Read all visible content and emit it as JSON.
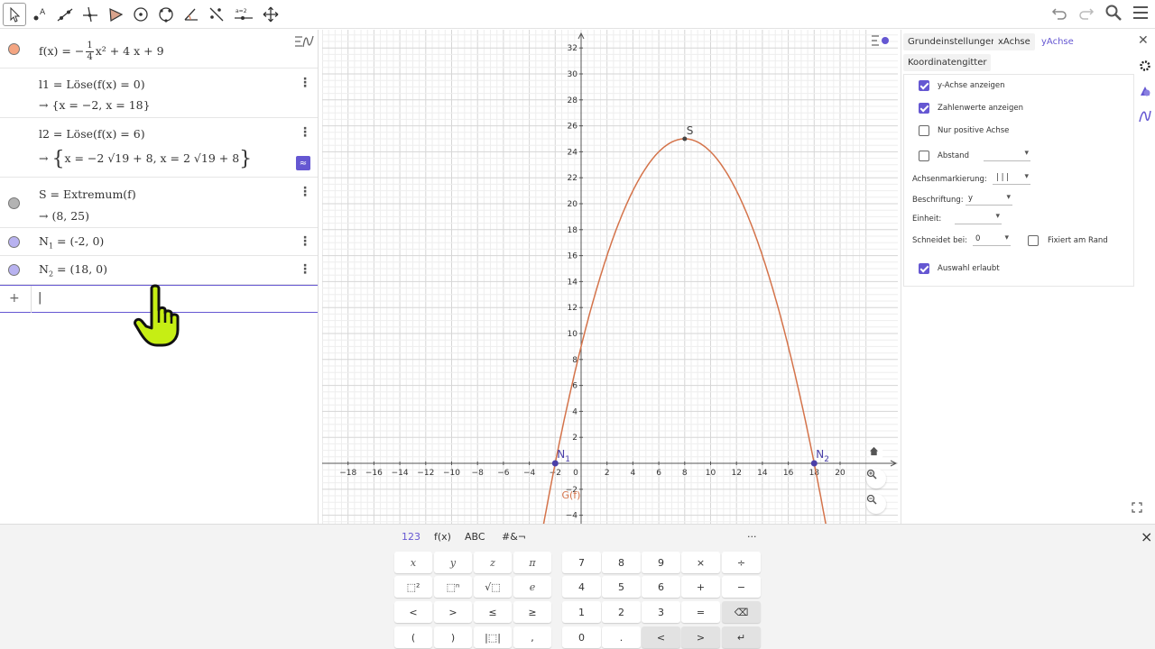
{
  "toolbar": {
    "tools": [
      "move-tool",
      "point-tool",
      "line-tool",
      "perpendicular-tool",
      "polygon-tool",
      "circle-tool",
      "circle-three-points-tool",
      "angle-tool",
      "reflect-tool",
      "slider-tool",
      "move-view-tool"
    ],
    "right": [
      "undo-icon",
      "redo-icon",
      "search-icon",
      "menu-icon"
    ],
    "slider_label": "a=2"
  },
  "algebra": {
    "rows": [
      {
        "id": "f",
        "prefix": "f(x) = −",
        "frac_num": "1",
        "frac_den": "4",
        "suffix": "x² + 4 x + 9",
        "color": "#f4a582"
      },
      {
        "id": "l1",
        "expr": "l1 = Löse(f(x) = 0)",
        "out": "→ {x = −2, x = 18}"
      },
      {
        "id": "l2",
        "expr": "l2 = Löse(f(x) = 6)",
        "out_a": "→ ",
        "out_b": "x = −2 √19 + 8, x = 2 √19 + 8",
        "toggle": "≈"
      },
      {
        "id": "s",
        "expr": "S = Extremum(f)",
        "out": "→ (8, 25)",
        "color": "#b3b3b3"
      },
      {
        "id": "n1",
        "expr_a": "N",
        "sub": "1",
        "expr_b": " = (-2, 0)",
        "color": "#b8b2f0"
      },
      {
        "id": "n2",
        "expr_a": "N",
        "sub": "2",
        "expr_b": " = (18, 0)",
        "color": "#b8b2f0"
      }
    ],
    "input_plus": "+",
    "input_value": "|"
  },
  "graphics": {
    "x_ticks": [
      "−18",
      "−16",
      "−14",
      "−12",
      "−10",
      "−8",
      "−6",
      "−4",
      "−2",
      "0",
      "2",
      "4",
      "6",
      "8",
      "10",
      "12",
      "14",
      "16",
      "18",
      "20"
    ],
    "y_ticks": [
      "32",
      "30",
      "28",
      "26",
      "24",
      "22",
      "20",
      "18",
      "16",
      "14",
      "12",
      "10",
      "8",
      "6",
      "4",
      "2",
      "−2",
      "−4"
    ],
    "curve_label": "G(f)",
    "point_s": "S",
    "point_n1": "N",
    "point_n1_sub": "1",
    "point_n2": "N",
    "point_n2_sub": "2",
    "curve_color": "#d4734a",
    "point_color": "#4a3fa8",
    "chart_data": {
      "type": "line",
      "title": "",
      "function": "f(x) = -1/4 x^2 + 4x + 9",
      "x": [
        -2,
        0,
        2,
        4,
        6,
        8,
        10,
        12,
        14,
        16,
        18
      ],
      "y": [
        0,
        9,
        16,
        21,
        24,
        25,
        24,
        21,
        16,
        9,
        0
      ],
      "points": [
        {
          "name": "S",
          "x": 8,
          "y": 25
        },
        {
          "name": "N1",
          "x": -2,
          "y": 0
        },
        {
          "name": "N2",
          "x": 18,
          "y": 0
        }
      ],
      "xlim": [
        -20,
        22
      ],
      "ylim": [
        -4,
        33
      ],
      "grid": true
    }
  },
  "settings": {
    "tabs": [
      "Grundeinstellungen",
      "xAchse",
      "yAchse",
      "Koordinatengitter"
    ],
    "active_tab": "yAchse",
    "show_y_axis": "y-Achse anzeigen",
    "show_numbers": "Zahlenwerte anzeigen",
    "positive_only": "Nur positive Achse",
    "distance": "Abstand",
    "axis_marking_label": "Achsenmarkierung:",
    "axis_marking_value": "| | |",
    "label_label": "Beschriftung:",
    "label_value": "y",
    "unit_label": "Einheit:",
    "unit_value": "",
    "crosses_label": "Schneidet bei:",
    "crosses_value": "0",
    "fixed_edge": "Fixiert am Rand",
    "selection_allowed": "Auswahl erlaubt"
  },
  "keyboard": {
    "tabs": [
      "123",
      "f(x)",
      "ABC",
      "#&¬"
    ],
    "more": "···",
    "close": "×",
    "left_keys": [
      [
        "x",
        "y",
        "z",
        "π"
      ],
      [
        "⬚²",
        "⬚ⁿ",
        "√⬚",
        "e"
      ],
      [
        "<",
        ">",
        "≤",
        "≥"
      ],
      [
        "(",
        ")",
        "|⬚|",
        ","
      ]
    ],
    "right_keys": [
      [
        "7",
        "8",
        "9",
        "×",
        "÷"
      ],
      [
        "4",
        "5",
        "6",
        "+",
        "−"
      ],
      [
        "1",
        "2",
        "3",
        "=",
        "⌫"
      ],
      [
        "0",
        ".",
        "<",
        ">",
        "↵"
      ]
    ]
  }
}
